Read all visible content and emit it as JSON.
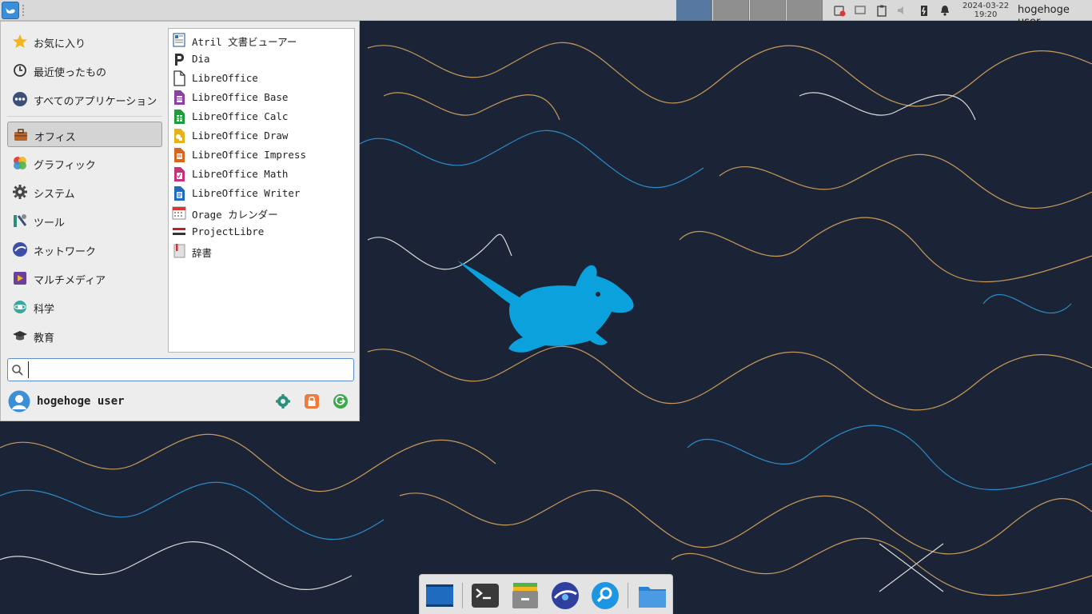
{
  "panel": {
    "clock_date": "2024-03-22",
    "clock_time": "19:20",
    "user": "hogehoge user",
    "accent": "#3a8fd8"
  },
  "menu": {
    "categories": [
      {
        "label": "お気に入り",
        "icon": "star-icon"
      },
      {
        "label": "最近使ったもの",
        "icon": "clock-icon"
      },
      {
        "label": "すべてのアプリケーション",
        "icon": "all-apps-icon"
      },
      {
        "label": "オフィス",
        "icon": "briefcase-icon",
        "selected": true
      },
      {
        "label": "グラフィック",
        "icon": "graphics-icon"
      },
      {
        "label": "システム",
        "icon": "system-gear-icon"
      },
      {
        "label": "ツール",
        "icon": "tools-icon"
      },
      {
        "label": "ネットワーク",
        "icon": "network-icon"
      },
      {
        "label": "マルチメディア",
        "icon": "multimedia-icon"
      },
      {
        "label": "科学",
        "icon": "science-icon"
      },
      {
        "label": "教育",
        "icon": "education-icon"
      }
    ],
    "apps": [
      {
        "label": "Atril 文書ビューアー",
        "icon": "atril-icon"
      },
      {
        "label": "Dia",
        "icon": "dia-icon"
      },
      {
        "label": "LibreOffice",
        "icon": "libreoffice-icon"
      },
      {
        "label": "LibreOffice Base",
        "icon": "libreoffice-base-icon"
      },
      {
        "label": "LibreOffice Calc",
        "icon": "libreoffice-calc-icon"
      },
      {
        "label": "LibreOffice Draw",
        "icon": "libreoffice-draw-icon"
      },
      {
        "label": "LibreOffice Impress",
        "icon": "libreoffice-impress-icon"
      },
      {
        "label": "LibreOffice Math",
        "icon": "libreoffice-math-icon"
      },
      {
        "label": "LibreOffice Writer",
        "icon": "libreoffice-writer-icon"
      },
      {
        "label": "Orage カレンダー",
        "icon": "calendar-icon"
      },
      {
        "label": "ProjectLibre",
        "icon": "projectlibre-icon"
      },
      {
        "label": "辞書",
        "icon": "dictionary-icon"
      }
    ],
    "search_value": "",
    "user": "hogehoge user"
  },
  "dock": {
    "items": [
      "show-desktop-icon",
      "terminal-icon",
      "file-manager-icon",
      "web-browser-icon",
      "app-finder-icon",
      "home-folder-icon"
    ]
  }
}
